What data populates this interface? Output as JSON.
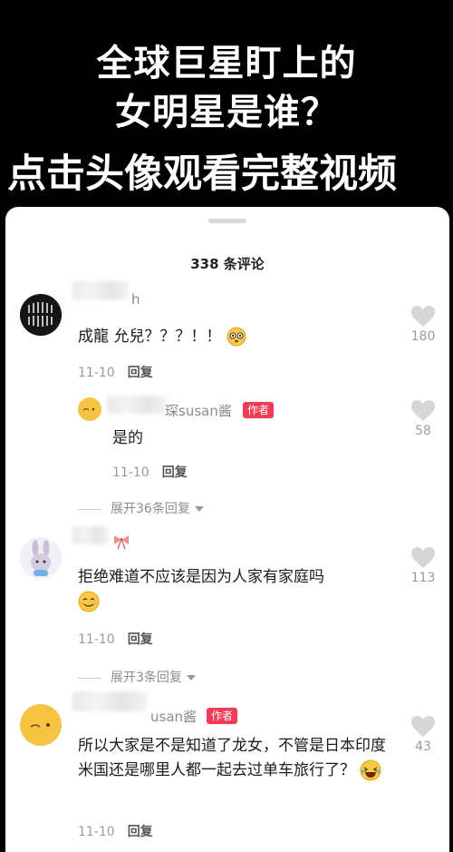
{
  "banner": {
    "line1": "全球巨星盯上的",
    "line2": "女明星是谁？",
    "line3": "点击头像观看完整视频"
  },
  "comments_header": {
    "count_label": "338 条评论"
  },
  "comments": [
    {
      "name": "h",
      "text": "成龍 允兒？？？！！",
      "emoji": "flushed-face-emoji",
      "date": "11-10",
      "reply_label": "回复",
      "likes": "180"
    },
    {
      "name": "琛susan酱",
      "badge": "作者",
      "text": "是的",
      "date": "11-10",
      "reply_label": "回复",
      "likes": "58"
    },
    {
      "name": "",
      "text": "拒绝难道不应该是因为人家有家庭吗",
      "emoji": "smiling-face-emoji",
      "date": "11-10",
      "reply_label": "回复",
      "likes": "113"
    },
    {
      "name": "usan酱",
      "badge": "作者",
      "text": "所以大家是不是知道了龙女，不管是日本印度米国还是哪里人都一起去过单车旅行了？",
      "emoji": "laughing-tears-emoji",
      "date": "11-10",
      "reply_label": "回复",
      "likes": "43"
    }
  ],
  "expanders": [
    {
      "label": "展开36条回复"
    },
    {
      "label": "展开3条回复"
    }
  ],
  "colors": {
    "badge": "#f23b56",
    "like_icon": "#d6d6d6",
    "avatar_yellow": "#f6c342"
  }
}
